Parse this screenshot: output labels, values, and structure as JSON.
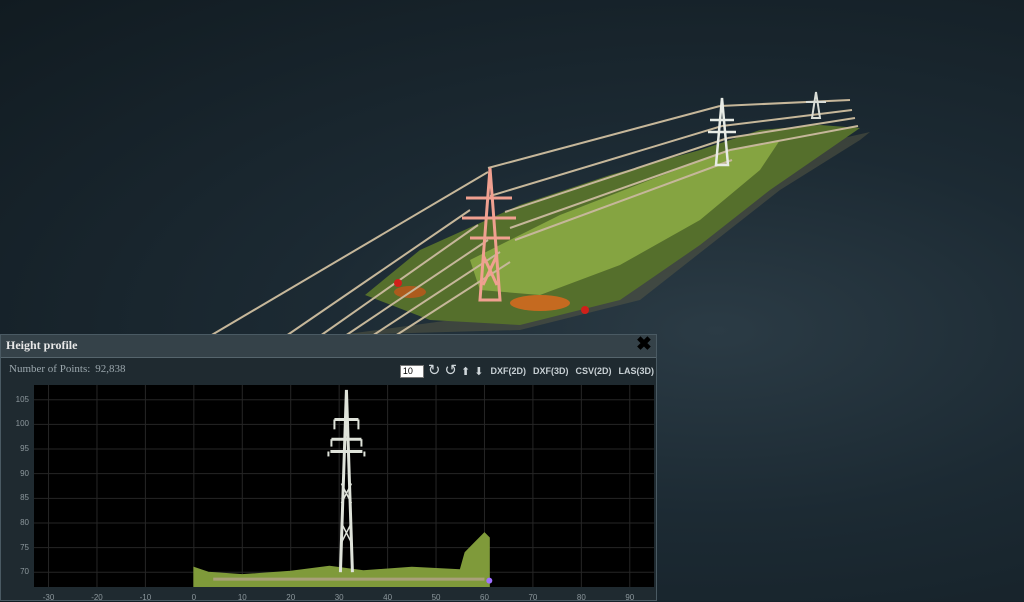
{
  "panel": {
    "title": "Height profile",
    "close_icon": "close-icon",
    "points_label": "Number of Points:",
    "points_value": "92,838",
    "width_value": "10",
    "toolbar": {
      "rotate_cw_icon": "rotate-cw-icon",
      "rotate_ccw_icon": "rotate-ccw-icon",
      "up_icon": "arrow-up-icon",
      "down_icon": "arrow-down-icon",
      "exports": [
        "DXF(2D)",
        "DXF(3D)",
        "CSV(2D)",
        "LAS(3D)"
      ]
    }
  },
  "chart_data": {
    "type": "scatter",
    "title": "",
    "xlabel": "",
    "ylabel": "",
    "x_ticks": [
      -30,
      -20,
      -10,
      0,
      10,
      20,
      30,
      40,
      50,
      60,
      70,
      80,
      90
    ],
    "y_ticks": [
      70,
      75,
      80,
      85,
      90,
      95,
      100,
      105
    ],
    "xlim": [
      -33,
      95
    ],
    "ylim": [
      67,
      108
    ],
    "grid": true,
    "colors": {
      "background": "#000000",
      "grid": "#262626",
      "tower": "#dfe3da",
      "vegetation": "#7f9a3a",
      "ground": "#a9a07a"
    }
  },
  "scene": {
    "tower_highlight_color": "#f0a090",
    "vegetation_color": "#6e8f36",
    "marker_color": "#d0201a"
  }
}
